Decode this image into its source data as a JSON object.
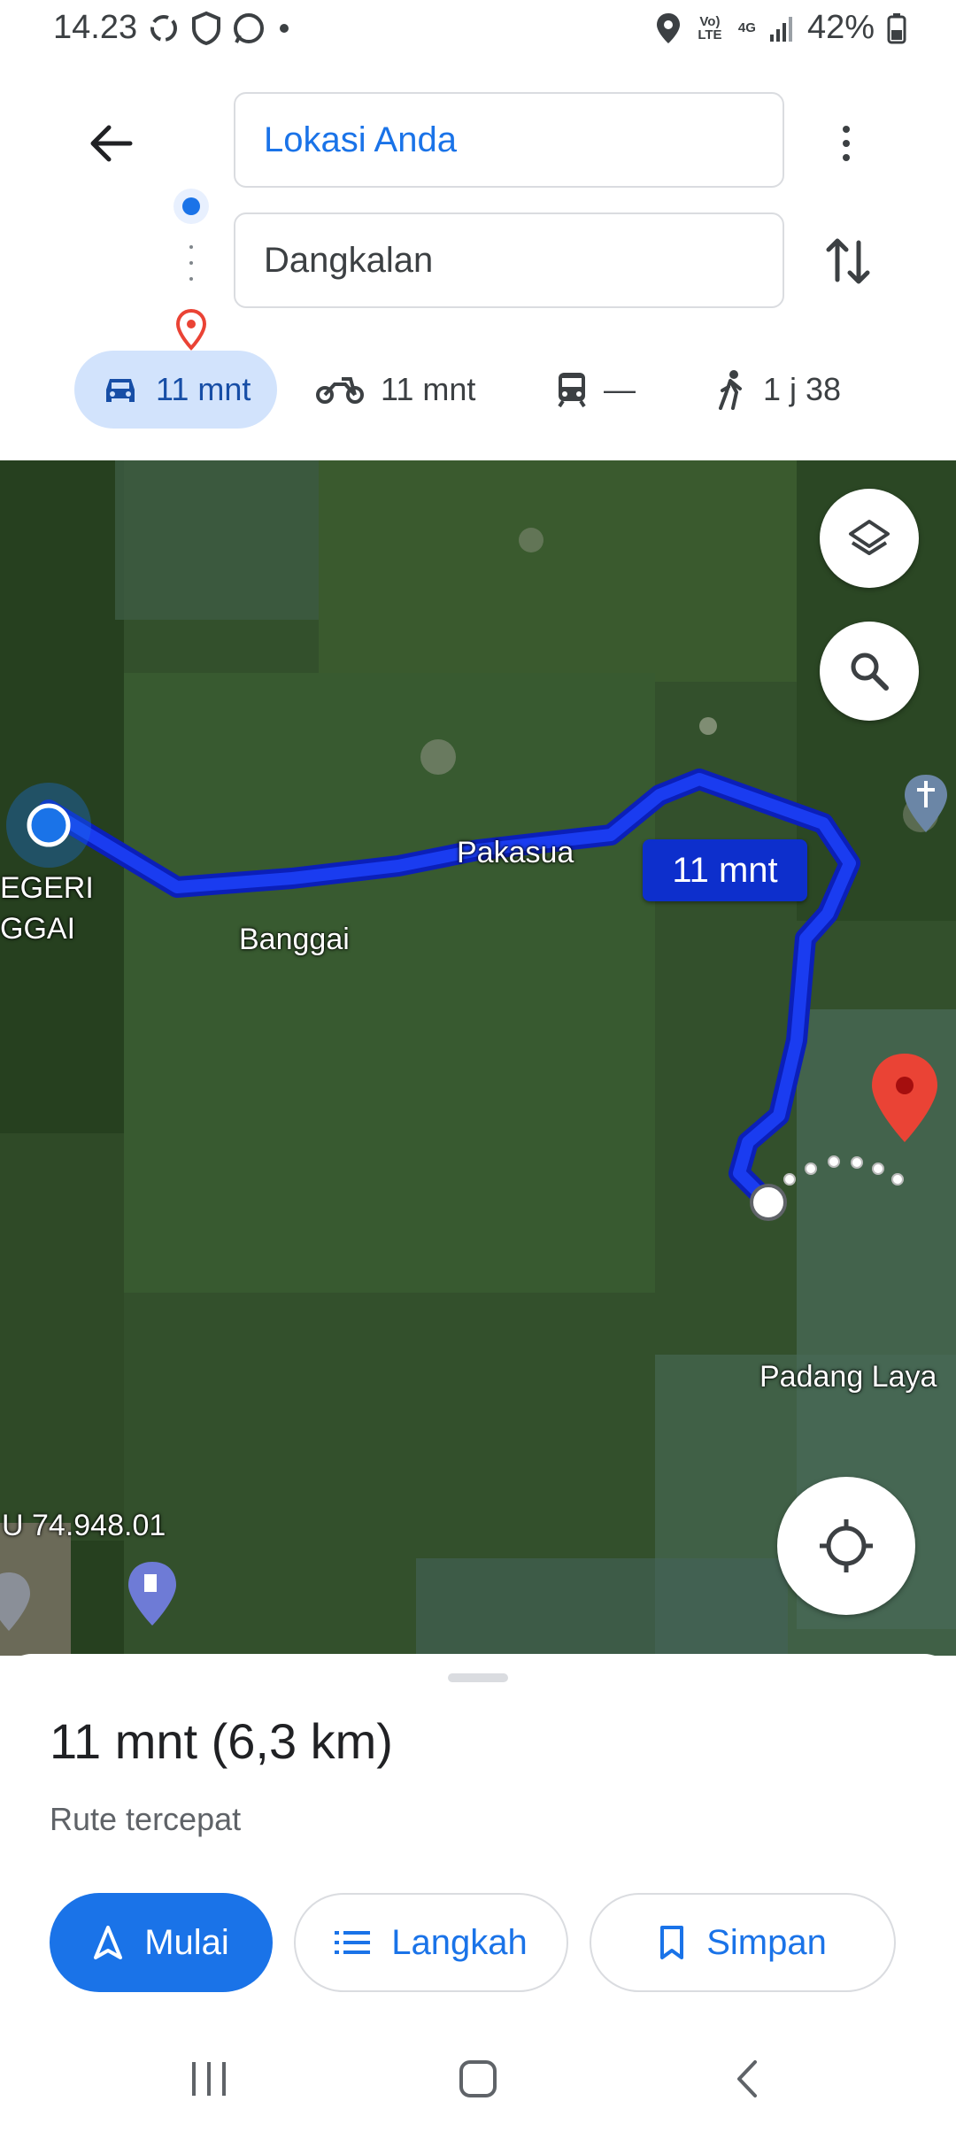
{
  "status_bar": {
    "time": "14.23",
    "network_lte": "Vo) LTE",
    "network_4g": "4G",
    "battery": "42%"
  },
  "directions": {
    "origin": "Lokasi Anda",
    "destination": "Dangkalan"
  },
  "modes": [
    {
      "name": "car",
      "time": "11 mnt",
      "active": true
    },
    {
      "name": "motorcycle",
      "time": "11 mnt",
      "active": false
    },
    {
      "name": "transit",
      "time": "—",
      "active": false
    },
    {
      "name": "walk",
      "time": "1 j 38",
      "active": false
    }
  ],
  "map": {
    "labels": {
      "pakasua": "Pakasua",
      "banggai": "Banggai",
      "egeri": "EGERI",
      "ggai": "GGAI",
      "padang_laya": "Padang Laya",
      "road_code": "U 74.948.01"
    },
    "route_time": "11 mnt",
    "route_color": "#1a3cf0"
  },
  "summary": {
    "title": "11 mnt (6,3 km)",
    "subtitle": "Rute tercepat"
  },
  "actions": {
    "start": "Mulai",
    "steps": "Langkah",
    "save": "Simpan"
  },
  "colors": {
    "accent": "#1a73e8",
    "chip_active": "#d2e3fc",
    "destination_pin": "#ea4335"
  }
}
